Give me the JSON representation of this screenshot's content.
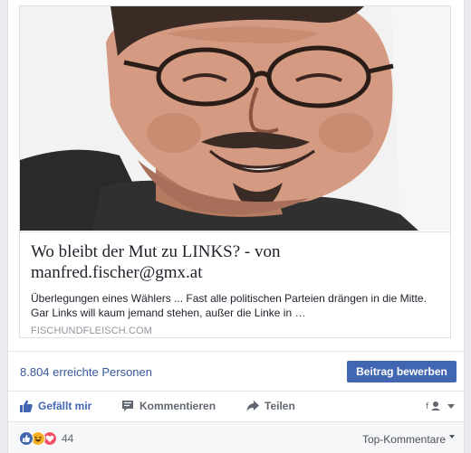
{
  "link_preview": {
    "title": "Wo bleibt der Mut zu LINKS? - von manfred.fischer@gmx.at",
    "description": "Überlegungen eines Wählers ... Fast alle politischen Parteien drängen in die Mitte. Gar Links will kaum jemand stehen, außer die Linke in …",
    "domain": "FISCHUNDFLEISCH.COM"
  },
  "insights": {
    "reach_text": "8.804 erreichte Personen",
    "boost_label": "Beitrag bewerben"
  },
  "actions": {
    "like_label": "Gefällt mir",
    "comment_label": "Kommentieren",
    "share_label": "Teilen"
  },
  "reactions": {
    "types": [
      "like",
      "haha",
      "love"
    ],
    "count": "44",
    "sort_label": "Top-Kommentare"
  },
  "colors": {
    "brand_blue": "#4267b2",
    "link_blue": "#365899",
    "love_red": "#f25268",
    "haha_yellow": "#f7b125"
  }
}
